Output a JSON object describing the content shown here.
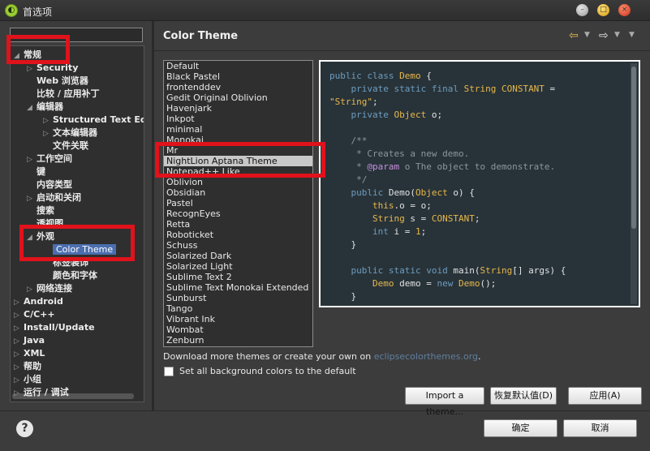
{
  "window": {
    "title": "首选项",
    "app_icon": "eclipse-icon",
    "controls": [
      "minimize-icon",
      "maximize-icon",
      "close-icon"
    ]
  },
  "sidebar": {
    "filter_placeholder": "",
    "items": [
      {
        "label": "常规",
        "level": 0,
        "expanded": true
      },
      {
        "label": "Security",
        "level": 1,
        "expanded": false
      },
      {
        "label": "Web 浏览器",
        "level": 1
      },
      {
        "label": "比较 / 应用补丁",
        "level": 1
      },
      {
        "label": "编辑器",
        "level": 1,
        "expanded": true
      },
      {
        "label": "Structured Text Editors",
        "level": 2,
        "expanded": false
      },
      {
        "label": "文本编辑器",
        "level": 2,
        "expanded": false
      },
      {
        "label": "文件关联",
        "level": 2
      },
      {
        "label": "工作空间",
        "level": 1,
        "expanded": false
      },
      {
        "label": "键",
        "level": 1
      },
      {
        "label": "内容类型",
        "level": 1
      },
      {
        "label": "启动和关闭",
        "level": 1,
        "expanded": false
      },
      {
        "label": "搜索",
        "level": 1
      },
      {
        "label": "透视图",
        "level": 1
      },
      {
        "label": "外观",
        "level": 1,
        "expanded": true
      },
      {
        "label": "Color Theme",
        "level": 2,
        "selected": true
      },
      {
        "label": "标签装饰",
        "level": 2
      },
      {
        "label": "颜色和字体",
        "level": 2
      },
      {
        "label": "网络连接",
        "level": 1,
        "expanded": false
      },
      {
        "label": "Android",
        "level": 0,
        "expanded": false
      },
      {
        "label": "C/C++",
        "level": 0,
        "expanded": false
      },
      {
        "label": "Install/Update",
        "level": 0,
        "expanded": false
      },
      {
        "label": "Java",
        "level": 0,
        "expanded": false
      },
      {
        "label": "XML",
        "level": 0,
        "expanded": false
      },
      {
        "label": "帮助",
        "level": 0,
        "expanded": false
      },
      {
        "label": "小组",
        "level": 0,
        "expanded": false
      },
      {
        "label": "运行 / 调试",
        "level": 0,
        "expanded": false
      }
    ]
  },
  "page": {
    "title": "Color Theme",
    "nav_icons": [
      "back-arrow-icon",
      "forward-arrow-icon",
      "view-menu-icon"
    ]
  },
  "themes": {
    "selected": "NightLion Aptana Theme",
    "items": [
      "Default",
      "Black Pastel",
      "frontenddev",
      "Gedit Original Oblivion",
      "Havenjark",
      "Inkpot",
      "minimal",
      "Monokai",
      "Mr",
      "NightLion Aptana Theme",
      "Notepad++ Like",
      "Oblivion",
      "Obsidian",
      "Pastel",
      "RecognEyes",
      "Retta",
      "Roboticket",
      "Schuss",
      "Solarized Dark",
      "Solarized Light",
      "Sublime Text 2",
      "Sublime Text Monokai Extended",
      "Sunburst",
      "Tango",
      "Vibrant Ink",
      "Wombat",
      "Zenburn"
    ]
  },
  "code_preview": {
    "background": "#283339",
    "lines": [
      [
        {
          "t": "public class ",
          "c": "kw"
        },
        {
          "t": "Demo",
          "c": "cls"
        },
        {
          "t": " {",
          "c": "txt"
        }
      ],
      [
        {
          "t": "    private static final ",
          "c": "kw"
        },
        {
          "t": "String",
          "c": "cls"
        },
        {
          "t": " CONSTANT",
          "c": "cls"
        },
        {
          "t": " =",
          "c": "txt"
        }
      ],
      [
        {
          "t": "\"String\"",
          "c": "str"
        },
        {
          "t": ";",
          "c": "txt"
        }
      ],
      [
        {
          "t": "    private ",
          "c": "kw"
        },
        {
          "t": "Object",
          "c": "cls"
        },
        {
          "t": " o;",
          "c": "txt"
        }
      ],
      [
        {
          "t": "",
          "c": "txt"
        }
      ],
      [
        {
          "t": "    /**",
          "c": "doc"
        }
      ],
      [
        {
          "t": "     * Creates a new demo.",
          "c": "doc"
        }
      ],
      [
        {
          "t": "     * ",
          "c": "doc"
        },
        {
          "t": "@param",
          "c": "param"
        },
        {
          "t": " o The object to demonstrate.",
          "c": "doc"
        }
      ],
      [
        {
          "t": "     */",
          "c": "doc"
        }
      ],
      [
        {
          "t": "    public ",
          "c": "kw"
        },
        {
          "t": "Demo",
          "c": "txt"
        },
        {
          "t": "(",
          "c": "txt"
        },
        {
          "t": "Object",
          "c": "cls"
        },
        {
          "t": " o) {",
          "c": "txt"
        }
      ],
      [
        {
          "t": "        this",
          "c": "cls"
        },
        {
          "t": ".o = o;",
          "c": "txt"
        }
      ],
      [
        {
          "t": "        String",
          "c": "cls"
        },
        {
          "t": " s = ",
          "c": "txt"
        },
        {
          "t": "CONSTANT",
          "c": "cls"
        },
        {
          "t": ";",
          "c": "txt"
        }
      ],
      [
        {
          "t": "        int",
          "c": "kw"
        },
        {
          "t": " i = ",
          "c": "txt"
        },
        {
          "t": "1",
          "c": "cls"
        },
        {
          "t": ";",
          "c": "txt"
        }
      ],
      [
        {
          "t": "    }",
          "c": "txt"
        }
      ],
      [
        {
          "t": "",
          "c": "txt"
        }
      ],
      [
        {
          "t": "    public static void ",
          "c": "kw"
        },
        {
          "t": "main",
          "c": "txt"
        },
        {
          "t": "(",
          "c": "txt"
        },
        {
          "t": "String",
          "c": "cls"
        },
        {
          "t": "[] args) {",
          "c": "txt"
        }
      ],
      [
        {
          "t": "        Demo",
          "c": "cls"
        },
        {
          "t": " demo = ",
          "c": "txt"
        },
        {
          "t": "new ",
          "c": "kw"
        },
        {
          "t": "Demo",
          "c": "cls"
        },
        {
          "t": "();",
          "c": "txt"
        }
      ],
      [
        {
          "t": "    }",
          "c": "txt"
        }
      ]
    ]
  },
  "download": {
    "text": "Download more themes or create your own on ",
    "link": "eclipsecolorthemes.org",
    "suffix": "."
  },
  "checkbox": {
    "label": "Set all background colors to the default",
    "checked": false
  },
  "buttons": {
    "import": "Import a theme...",
    "restore_defaults": "恢复默认值(D)",
    "apply": "应用(A)",
    "ok": "确定",
    "cancel": "取消"
  },
  "help": {
    "icon": "help-icon",
    "glyph": "?"
  },
  "colors": {
    "highlight": "#e0121b",
    "selection": "#4b6eaf",
    "window_bg": "#3c3c3c"
  }
}
